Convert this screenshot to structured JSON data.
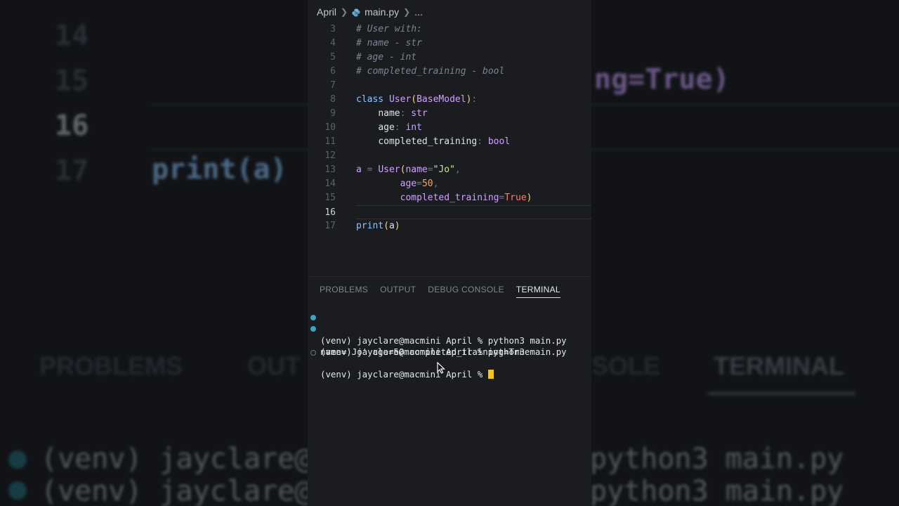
{
  "breadcrumb": {
    "folder": "April",
    "file": "main.py",
    "more": "..."
  },
  "editor": {
    "current_line": "16",
    "lines": [
      {
        "n": "3",
        "t": "# User with:"
      },
      {
        "n": "4",
        "t": "# name - str"
      },
      {
        "n": "5",
        "t": "# age - int"
      },
      {
        "n": "6",
        "t": "# completed_training - bool"
      },
      {
        "n": "7",
        "t": ""
      },
      {
        "n": "8",
        "t": "class User(BaseModel):"
      },
      {
        "n": "9",
        "t": "    name: str"
      },
      {
        "n": "10",
        "t": "    age: int"
      },
      {
        "n": "11",
        "t": "    completed_training: bool"
      },
      {
        "n": "12",
        "t": ""
      },
      {
        "n": "13",
        "t": "a = User(name=\"Jo\","
      },
      {
        "n": "14",
        "t": "        age=50,"
      },
      {
        "n": "15",
        "t": "        completed_training=True)"
      },
      {
        "n": "16",
        "t": ""
      },
      {
        "n": "17",
        "t": "print(a)"
      }
    ]
  },
  "panel": {
    "tabs": [
      "PROBLEMS",
      "OUTPUT",
      "DEBUG CONSOLE",
      "TERMINAL"
    ],
    "active": "TERMINAL"
  },
  "terminal": {
    "lines": [
      "(venv) jayclare@macmini April % python3 main.py",
      "(venv) jayclare@macmini April % python3 main.py",
      "name='Jo' age=50 completed_training=True",
      "(venv) jayclare@macmini April % "
    ]
  },
  "background": {
    "nums": [
      "14",
      "15",
      "16",
      "17"
    ],
    "code_16_tail": "ng=True)",
    "print": "print(a)",
    "tabs": [
      "PROBLEMS",
      "OUT",
      "SOLE",
      "TERMINAL"
    ],
    "term_1_left": "(venv) jayclare@",
    "term_1_right": "python3 main.py",
    "term_2_left": "(venv) jayclare@",
    "term_2_right": "python3 main.py"
  },
  "colors": {
    "accent_cursor": "#f5c518",
    "dot_blue": "#3ca3c0",
    "keyword": "#8fc4ff",
    "class": "#cfa2ff",
    "string": "#c5e88c",
    "number": "#f2a46a",
    "true": "#ff7b6b"
  }
}
